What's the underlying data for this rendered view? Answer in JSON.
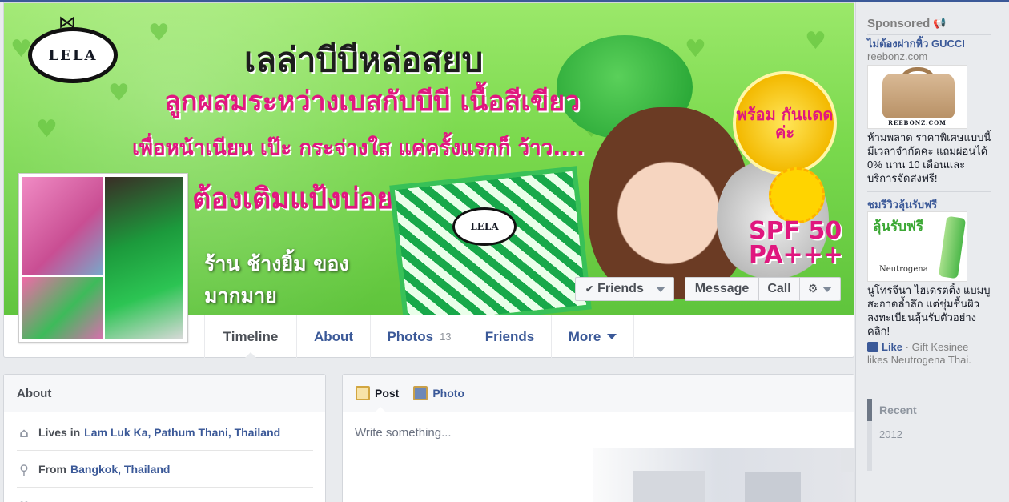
{
  "cover": {
    "logo_text": "LELA",
    "headline": "เลล่าบีบีหล่อสยบ",
    "subheadline": "ลูกผสมระหว่างเบสกับบีบี เนื้อสีเขียว",
    "tagline": "เพื่อหน้าเนียน เป๊ะ กระจ่างใส แค่ครั้งแรกก็ ว้าว....",
    "badge_text": "พร้อม กันแดดค่ะ",
    "spf_text": "SPF 50",
    "pa_text": "PA+++",
    "partial_line": "ต้องเติมแป้งบ่อยๆ"
  },
  "page": {
    "name": "ร้าน ช้างยิ้ม ของ มากมาย"
  },
  "buttons": {
    "friends": "Friends",
    "message": "Message",
    "call": "Call"
  },
  "tabs": {
    "timeline": "Timeline",
    "about": "About",
    "photos": "Photos",
    "photos_count": "13",
    "friends": "Friends",
    "more": "More"
  },
  "about": {
    "title": "About",
    "lives_in_label": "Lives in",
    "lives_in": "Lam Luk Ka, Pathum Thani, Thailand",
    "from_label": "From",
    "from": "Bangkok, Thailand"
  },
  "composer": {
    "post": "Post",
    "photo": "Photo",
    "placeholder": "Write something..."
  },
  "sidebar": {
    "sponsored": "Sponsored",
    "ads": [
      {
        "title": "ไม่ต้องฝากหิ้ว GUCCI",
        "source": "reebonz.com",
        "image_brand": "REEBONZ.COM",
        "description": "ห้ามพลาด ราคาพิเศษแบบนี้มีเวลาจำกัดคะ แถมผ่อนได้ 0% นาน 10 เดือนและบริการจัดส่งฟรี!"
      },
      {
        "title": "ชมรีวิวลุ้นรับฟรี",
        "image_text": "ลุ้นรับฟรี",
        "image_brand": "Neutrogena",
        "description": "นูโทรจีนา ไฮเดรตติ้ง แบมบู สะอาดล้ำลึก แต่ชุ่มชื้นผิว ลงทะเบียนลุ้นรับตัวอย่าง คลิก!",
        "like_label": "Like",
        "social": "Gift Kesinee likes Neutrogena Thai."
      }
    ],
    "recent": "Recent",
    "year": "2012"
  }
}
